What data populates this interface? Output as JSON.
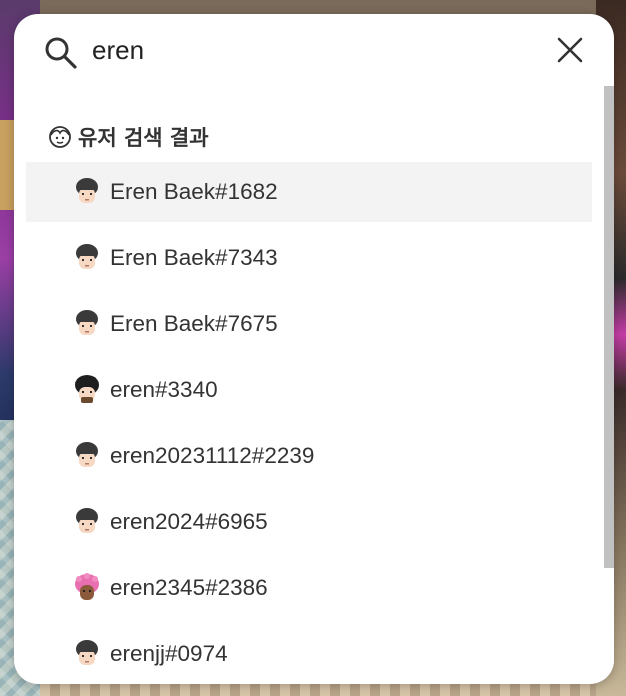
{
  "search": {
    "query": "eren",
    "placeholder": ""
  },
  "results": {
    "section_title": "유저 검색 결과",
    "items": [
      {
        "name": "Eren Baek#1682",
        "avatar": "avatar-icon"
      },
      {
        "name": "Eren Baek#7343",
        "avatar": "avatar-icon"
      },
      {
        "name": "Eren Baek#7675",
        "avatar": "avatar-icon"
      },
      {
        "name": "eren#3340",
        "avatar": "avatar-icon"
      },
      {
        "name": "eren20231112#2239",
        "avatar": "avatar-icon"
      },
      {
        "name": "eren2024#6965",
        "avatar": "avatar-icon"
      },
      {
        "name": "eren2345#2386",
        "avatar": "avatar-icon"
      },
      {
        "name": "erenjj#0974",
        "avatar": "avatar-icon"
      }
    ]
  },
  "icons": {
    "search": "search-icon",
    "close": "close-icon",
    "section": "user-face-icon"
  },
  "colors": {
    "highlight": "#f3f3f3",
    "text": "#333333"
  }
}
